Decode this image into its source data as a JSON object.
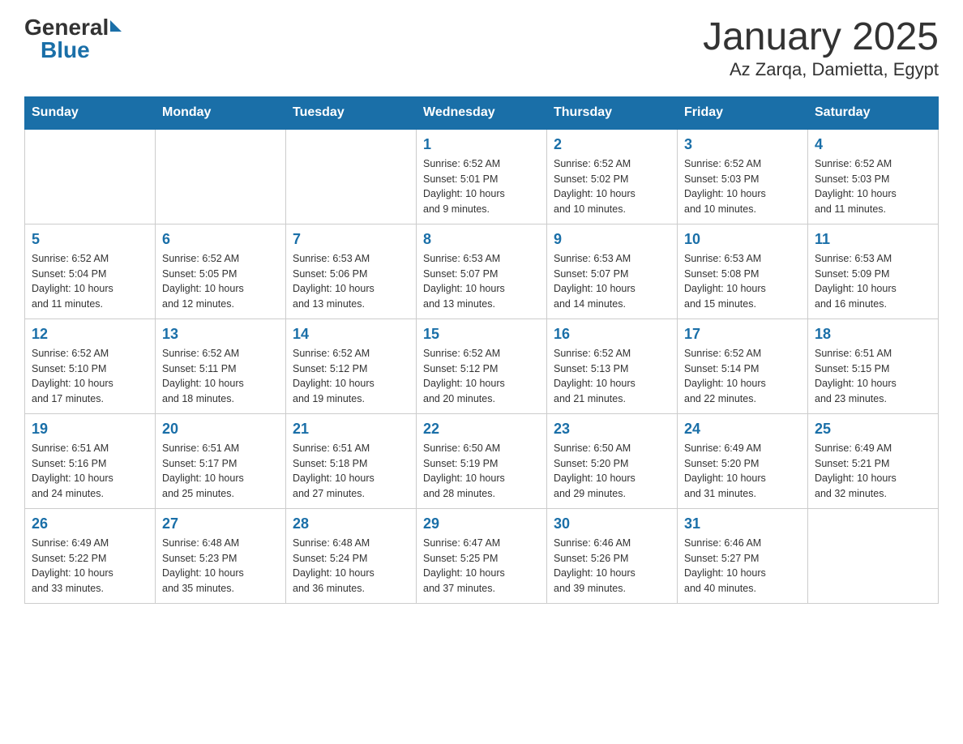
{
  "header": {
    "logo_general": "General",
    "logo_blue": "Blue",
    "title": "January 2025",
    "subtitle": "Az Zarqa, Damietta, Egypt"
  },
  "weekdays": [
    "Sunday",
    "Monday",
    "Tuesday",
    "Wednesday",
    "Thursday",
    "Friday",
    "Saturday"
  ],
  "weeks": [
    [
      {
        "day": "",
        "info": ""
      },
      {
        "day": "",
        "info": ""
      },
      {
        "day": "",
        "info": ""
      },
      {
        "day": "1",
        "info": "Sunrise: 6:52 AM\nSunset: 5:01 PM\nDaylight: 10 hours\nand 9 minutes."
      },
      {
        "day": "2",
        "info": "Sunrise: 6:52 AM\nSunset: 5:02 PM\nDaylight: 10 hours\nand 10 minutes."
      },
      {
        "day": "3",
        "info": "Sunrise: 6:52 AM\nSunset: 5:03 PM\nDaylight: 10 hours\nand 10 minutes."
      },
      {
        "day": "4",
        "info": "Sunrise: 6:52 AM\nSunset: 5:03 PM\nDaylight: 10 hours\nand 11 minutes."
      }
    ],
    [
      {
        "day": "5",
        "info": "Sunrise: 6:52 AM\nSunset: 5:04 PM\nDaylight: 10 hours\nand 11 minutes."
      },
      {
        "day": "6",
        "info": "Sunrise: 6:52 AM\nSunset: 5:05 PM\nDaylight: 10 hours\nand 12 minutes."
      },
      {
        "day": "7",
        "info": "Sunrise: 6:53 AM\nSunset: 5:06 PM\nDaylight: 10 hours\nand 13 minutes."
      },
      {
        "day": "8",
        "info": "Sunrise: 6:53 AM\nSunset: 5:07 PM\nDaylight: 10 hours\nand 13 minutes."
      },
      {
        "day": "9",
        "info": "Sunrise: 6:53 AM\nSunset: 5:07 PM\nDaylight: 10 hours\nand 14 minutes."
      },
      {
        "day": "10",
        "info": "Sunrise: 6:53 AM\nSunset: 5:08 PM\nDaylight: 10 hours\nand 15 minutes."
      },
      {
        "day": "11",
        "info": "Sunrise: 6:53 AM\nSunset: 5:09 PM\nDaylight: 10 hours\nand 16 minutes."
      }
    ],
    [
      {
        "day": "12",
        "info": "Sunrise: 6:52 AM\nSunset: 5:10 PM\nDaylight: 10 hours\nand 17 minutes."
      },
      {
        "day": "13",
        "info": "Sunrise: 6:52 AM\nSunset: 5:11 PM\nDaylight: 10 hours\nand 18 minutes."
      },
      {
        "day": "14",
        "info": "Sunrise: 6:52 AM\nSunset: 5:12 PM\nDaylight: 10 hours\nand 19 minutes."
      },
      {
        "day": "15",
        "info": "Sunrise: 6:52 AM\nSunset: 5:12 PM\nDaylight: 10 hours\nand 20 minutes."
      },
      {
        "day": "16",
        "info": "Sunrise: 6:52 AM\nSunset: 5:13 PM\nDaylight: 10 hours\nand 21 minutes."
      },
      {
        "day": "17",
        "info": "Sunrise: 6:52 AM\nSunset: 5:14 PM\nDaylight: 10 hours\nand 22 minutes."
      },
      {
        "day": "18",
        "info": "Sunrise: 6:51 AM\nSunset: 5:15 PM\nDaylight: 10 hours\nand 23 minutes."
      }
    ],
    [
      {
        "day": "19",
        "info": "Sunrise: 6:51 AM\nSunset: 5:16 PM\nDaylight: 10 hours\nand 24 minutes."
      },
      {
        "day": "20",
        "info": "Sunrise: 6:51 AM\nSunset: 5:17 PM\nDaylight: 10 hours\nand 25 minutes."
      },
      {
        "day": "21",
        "info": "Sunrise: 6:51 AM\nSunset: 5:18 PM\nDaylight: 10 hours\nand 27 minutes."
      },
      {
        "day": "22",
        "info": "Sunrise: 6:50 AM\nSunset: 5:19 PM\nDaylight: 10 hours\nand 28 minutes."
      },
      {
        "day": "23",
        "info": "Sunrise: 6:50 AM\nSunset: 5:20 PM\nDaylight: 10 hours\nand 29 minutes."
      },
      {
        "day": "24",
        "info": "Sunrise: 6:49 AM\nSunset: 5:20 PM\nDaylight: 10 hours\nand 31 minutes."
      },
      {
        "day": "25",
        "info": "Sunrise: 6:49 AM\nSunset: 5:21 PM\nDaylight: 10 hours\nand 32 minutes."
      }
    ],
    [
      {
        "day": "26",
        "info": "Sunrise: 6:49 AM\nSunset: 5:22 PM\nDaylight: 10 hours\nand 33 minutes."
      },
      {
        "day": "27",
        "info": "Sunrise: 6:48 AM\nSunset: 5:23 PM\nDaylight: 10 hours\nand 35 minutes."
      },
      {
        "day": "28",
        "info": "Sunrise: 6:48 AM\nSunset: 5:24 PM\nDaylight: 10 hours\nand 36 minutes."
      },
      {
        "day": "29",
        "info": "Sunrise: 6:47 AM\nSunset: 5:25 PM\nDaylight: 10 hours\nand 37 minutes."
      },
      {
        "day": "30",
        "info": "Sunrise: 6:46 AM\nSunset: 5:26 PM\nDaylight: 10 hours\nand 39 minutes."
      },
      {
        "day": "31",
        "info": "Sunrise: 6:46 AM\nSunset: 5:27 PM\nDaylight: 10 hours\nand 40 minutes."
      },
      {
        "day": "",
        "info": ""
      }
    ]
  ]
}
